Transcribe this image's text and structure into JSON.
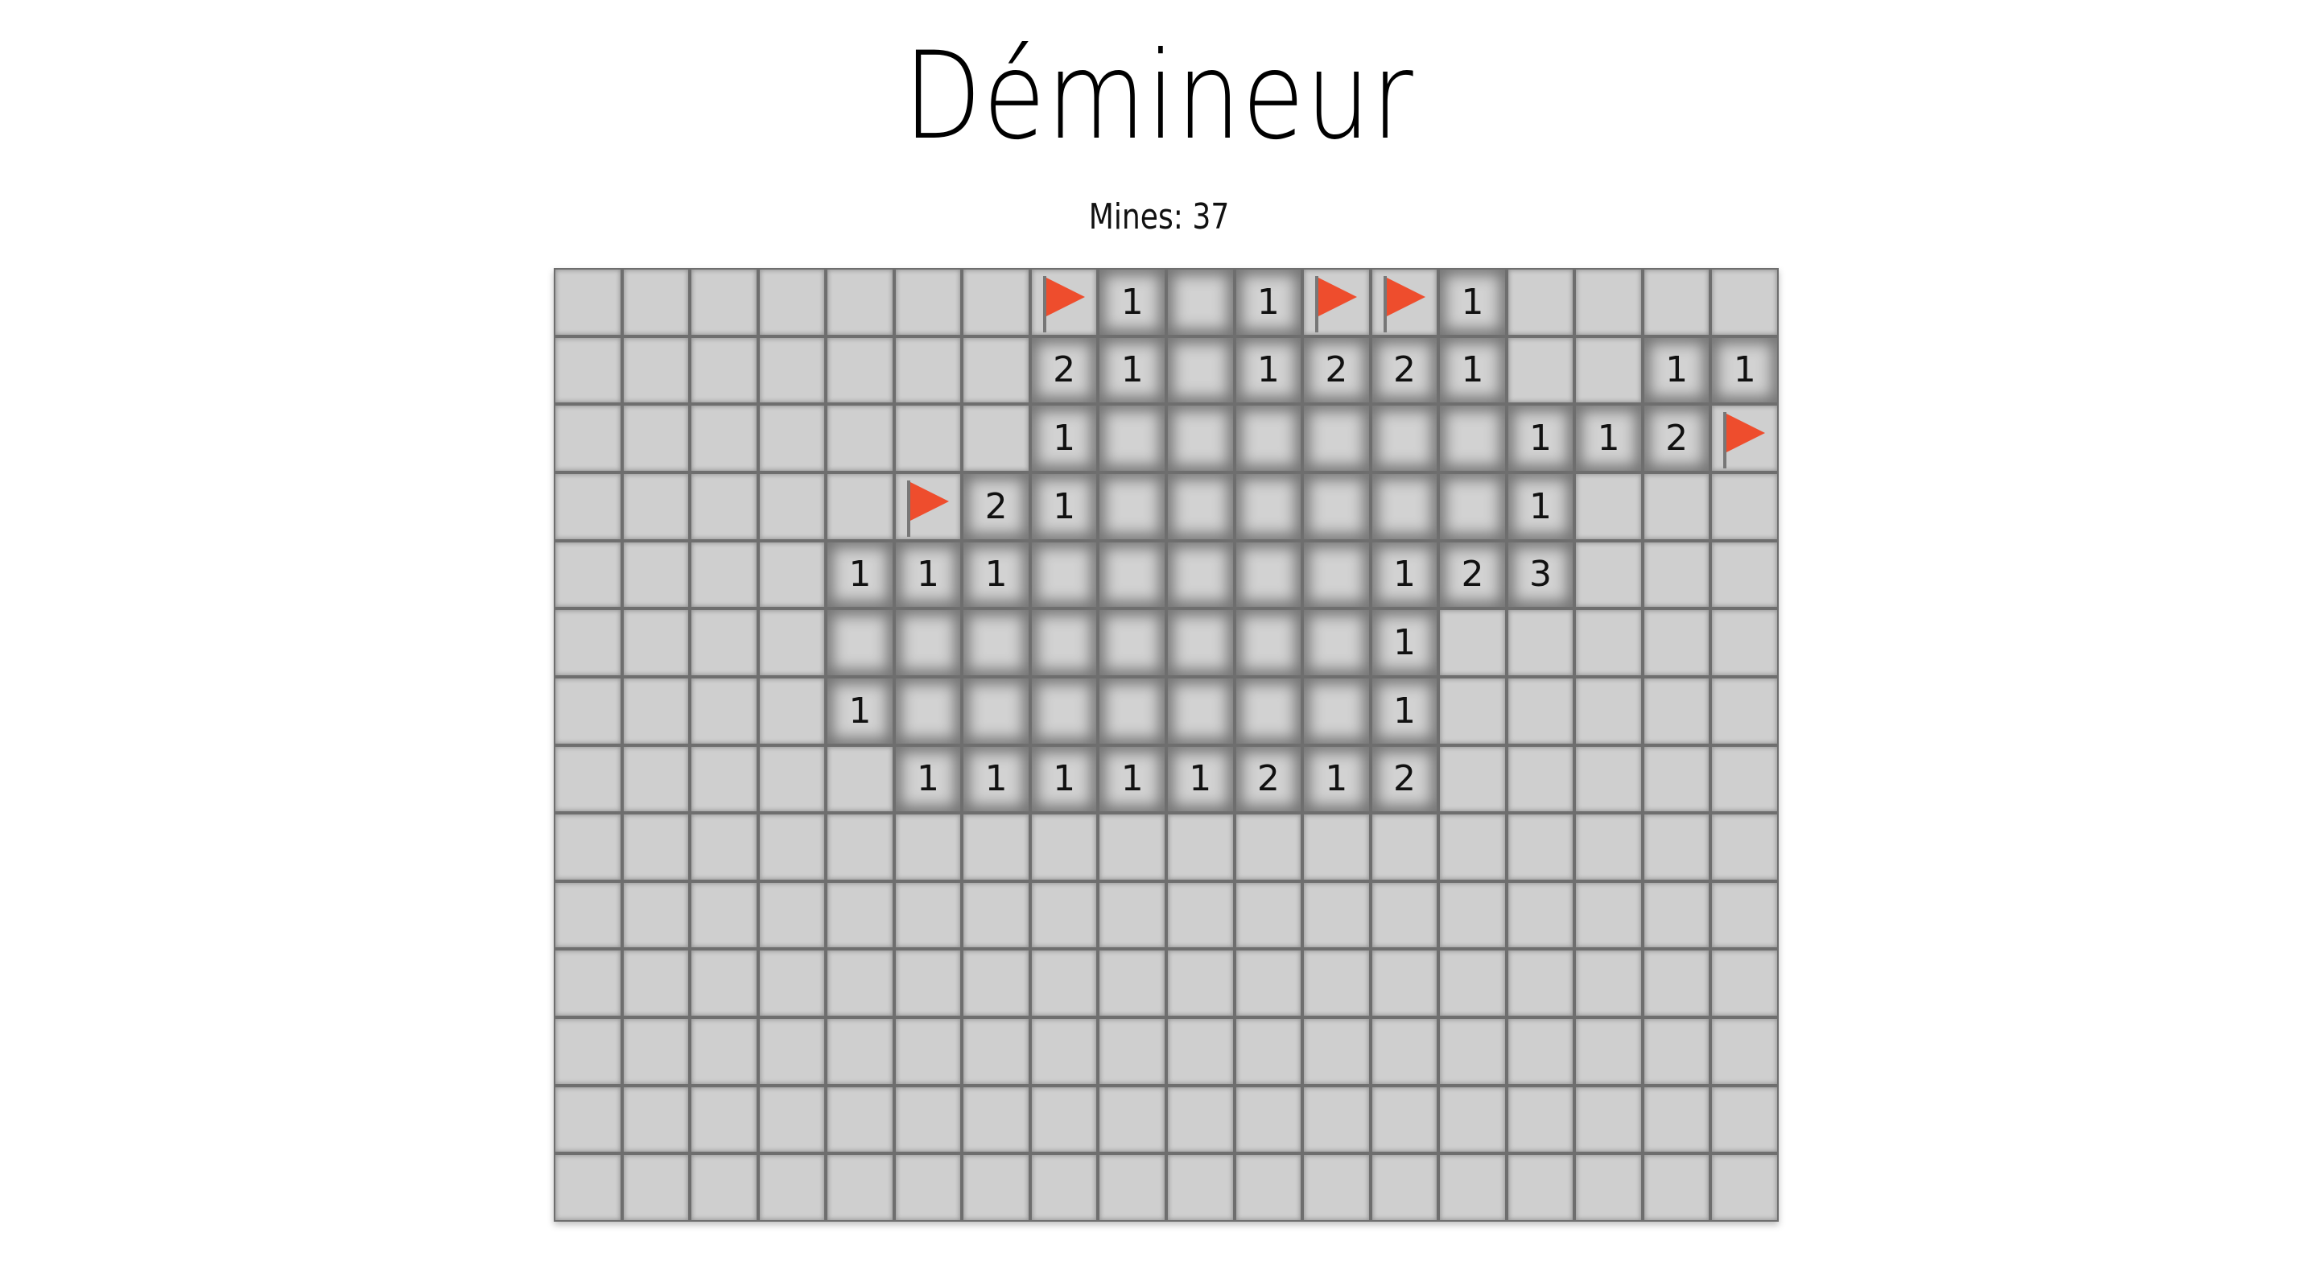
{
  "title": "Démineur",
  "mines_label": "Mines: 37",
  "colors": {
    "flag": "#ee4d2d",
    "closed_cell": "#cfcfcf",
    "open_cell": "#d2d2d2",
    "grid_line": "#6e6e6e"
  },
  "board": {
    "columns": 18,
    "legend": "C = closed cell, F = flagged cell, 0 = opened empty cell, digit = opened cell showing adjacent mine count",
    "rows": [
      [
        "C",
        "C",
        "C",
        "C",
        "C",
        "C",
        "C",
        "F",
        "1",
        "0",
        "1",
        "F",
        "F",
        "1",
        "C",
        "C",
        "C",
        "C"
      ],
      [
        "C",
        "C",
        "C",
        "C",
        "C",
        "C",
        "C",
        "2",
        "1",
        "0",
        "1",
        "2",
        "2",
        "1",
        "C",
        "C",
        "1",
        "1"
      ],
      [
        "C",
        "C",
        "C",
        "C",
        "C",
        "C",
        "C",
        "1",
        "0",
        "0",
        "0",
        "0",
        "0",
        "0",
        "1",
        "1",
        "2",
        "F"
      ],
      [
        "C",
        "C",
        "C",
        "C",
        "C",
        "F",
        "2",
        "1",
        "0",
        "0",
        "0",
        "0",
        "0",
        "0",
        "1",
        "C",
        "C",
        "C"
      ],
      [
        "C",
        "C",
        "C",
        "C",
        "1",
        "1",
        "1",
        "0",
        "0",
        "0",
        "0",
        "0",
        "1",
        "2",
        "3",
        "C",
        "C",
        "C"
      ],
      [
        "C",
        "C",
        "C",
        "C",
        "0",
        "0",
        "0",
        "0",
        "0",
        "0",
        "0",
        "0",
        "1",
        "C",
        "C",
        "C",
        "C",
        "C"
      ],
      [
        "C",
        "C",
        "C",
        "C",
        "1",
        "0",
        "0",
        "0",
        "0",
        "0",
        "0",
        "0",
        "1",
        "C",
        "C",
        "C",
        "C",
        "C"
      ],
      [
        "C",
        "C",
        "C",
        "C",
        "C",
        "1",
        "1",
        "1",
        "1",
        "1",
        "2",
        "1",
        "2",
        "C",
        "C",
        "C",
        "C",
        "C"
      ],
      [
        "C",
        "C",
        "C",
        "C",
        "C",
        "C",
        "C",
        "C",
        "C",
        "C",
        "C",
        "C",
        "C",
        "C",
        "C",
        "C",
        "C",
        "C"
      ],
      [
        "C",
        "C",
        "C",
        "C",
        "C",
        "C",
        "C",
        "C",
        "C",
        "C",
        "C",
        "C",
        "C",
        "C",
        "C",
        "C",
        "C",
        "C"
      ],
      [
        "C",
        "C",
        "C",
        "C",
        "C",
        "C",
        "C",
        "C",
        "C",
        "C",
        "C",
        "C",
        "C",
        "C",
        "C",
        "C",
        "C",
        "C"
      ],
      [
        "C",
        "C",
        "C",
        "C",
        "C",
        "C",
        "C",
        "C",
        "C",
        "C",
        "C",
        "C",
        "C",
        "C",
        "C",
        "C",
        "C",
        "C"
      ],
      [
        "C",
        "C",
        "C",
        "C",
        "C",
        "C",
        "C",
        "C",
        "C",
        "C",
        "C",
        "C",
        "C",
        "C",
        "C",
        "C",
        "C",
        "C"
      ],
      [
        "C",
        "C",
        "C",
        "C",
        "C",
        "C",
        "C",
        "C",
        "C",
        "C",
        "C",
        "C",
        "C",
        "C",
        "C",
        "C",
        "C",
        "C"
      ]
    ]
  }
}
